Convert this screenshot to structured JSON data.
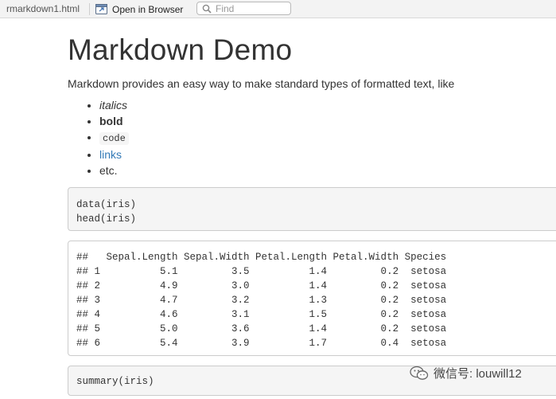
{
  "toolbar": {
    "filename": "rmarkdown1.html",
    "open_in_browser": "Open in Browser",
    "find_placeholder": "Find"
  },
  "doc": {
    "title": "Markdown Demo",
    "intro": "Markdown provides an easy way to make standard types of formatted text, like",
    "list": {
      "italics": "italics",
      "bold": "bold",
      "code": "code",
      "links": "links",
      "etc": "etc."
    }
  },
  "blocks": {
    "code1": "data(iris)\nhead(iris)",
    "output1": "##   Sepal.Length Sepal.Width Petal.Length Petal.Width Species\n## 1          5.1         3.5          1.4         0.2  setosa\n## 2          4.9         3.0          1.4         0.2  setosa\n## 3          4.7         3.2          1.3         0.2  setosa\n## 4          4.6         3.1          1.5         0.2  setosa\n## 5          5.0         3.6          1.4         0.2  setosa\n## 6          5.4         3.9          1.7         0.4  setosa",
    "code2": "summary(iris)"
  },
  "watermark": {
    "text": "微信号: louwill12"
  },
  "colors": {
    "link": "#337ab7",
    "code_bg": "#f5f5f5",
    "border": "#cccccc"
  },
  "icons": {
    "open_in_browser": "browser-window-icon",
    "find": "search-icon",
    "watermark": "wechat-icon"
  }
}
